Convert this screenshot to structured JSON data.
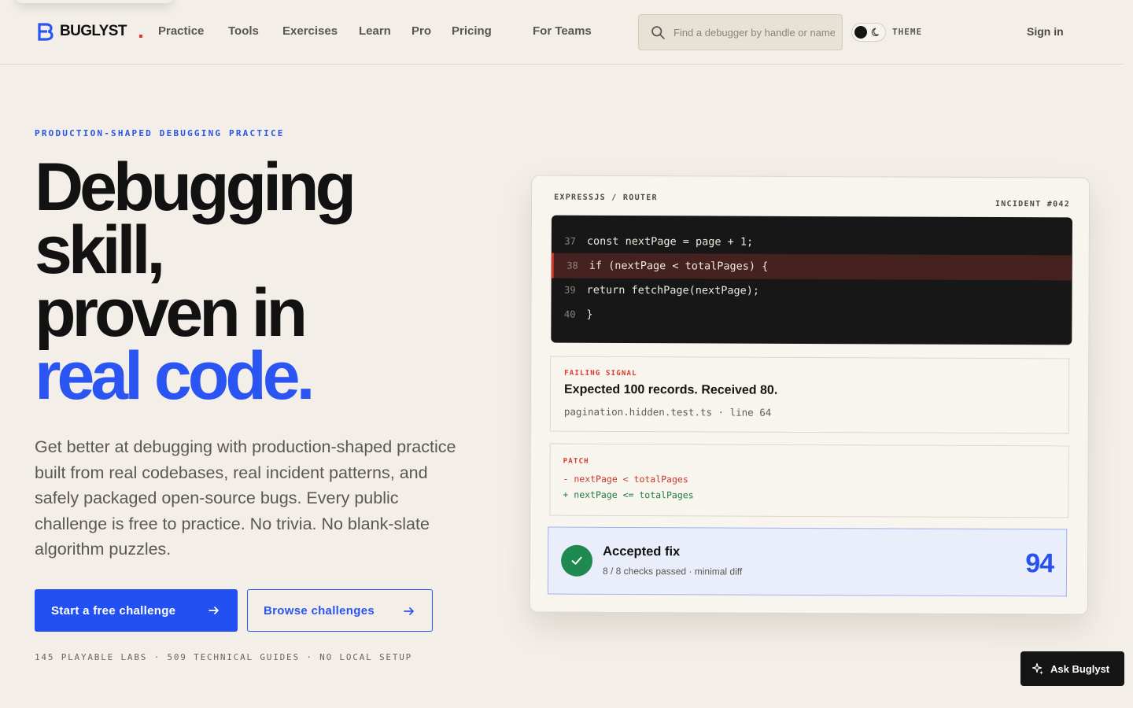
{
  "brand": {
    "name": "BUGLYST",
    "accent_color": "#2a55f2",
    "dot_color": "#e3362d"
  },
  "nav": {
    "links": [
      "Practice",
      "Tools",
      "Exercises",
      "Learn",
      "Pro",
      "Pricing",
      "For Teams"
    ],
    "search_placeholder": "Find a debugger by handle or name",
    "theme_label": "THEME",
    "signin": "Sign in"
  },
  "hero": {
    "eyebrow": "PRODUCTION-SHAPED DEBUGGING PRACTICE",
    "headline_lines": [
      "Debugging",
      "skill,",
      "proven in"
    ],
    "headline_accent": "real code.",
    "lede": "Get better at debugging with production-shaped practice built from real codebases, real incident patterns, and safely packaged open-source bugs. Every public challenge is free to practice. No trivia. No blank-slate algorithm puzzles.",
    "primary_cta": "Start a free challenge",
    "secondary_cta": "Browse challenges",
    "stats": "145 PLAYABLE LABS · 509 TECHNICAL GUIDES · NO LOCAL SETUP"
  },
  "card": {
    "crumb": "EXPRESSJS / ROUTER",
    "incident": "INCIDENT #042",
    "code": [
      {
        "line": "37",
        "text": "const nextPage = page + 1;"
      },
      {
        "line": "38",
        "text": "if (nextPage < totalPages) {"
      },
      {
        "line": "39",
        "text": "return fetchPage(nextPage);"
      },
      {
        "line": "40",
        "text": "}"
      }
    ],
    "highlighted_line": "38",
    "signal_label": "FAILING SIGNAL",
    "signal_title": "Expected 100 records. Received 80.",
    "signal_meta": "pagination.hidden.test.ts · line 64",
    "patch_label": "PATCH",
    "patch_removed": "- nextPage < totalPages",
    "patch_added": "+ nextPage <= totalPages",
    "accepted_title": "Accepted fix",
    "accepted_sub": "8 / 8 checks passed · minimal diff",
    "score": "94"
  },
  "assistant": {
    "label": "Ask Buglyst"
  }
}
